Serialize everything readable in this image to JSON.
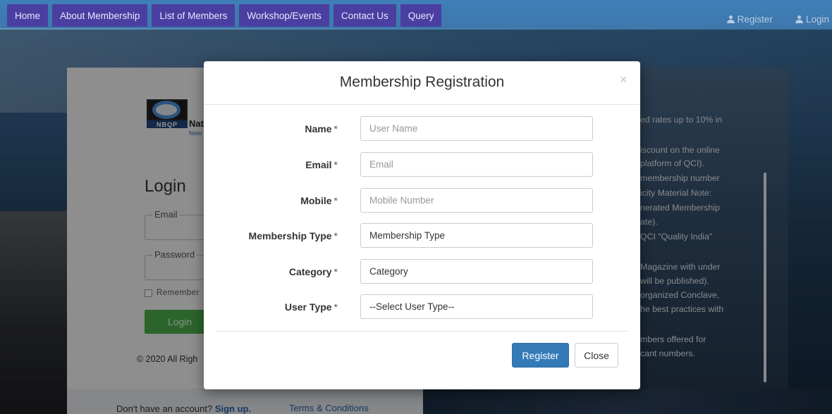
{
  "nav": {
    "items": [
      {
        "label": "Home"
      },
      {
        "label": "About Membership"
      },
      {
        "label": "List of Members"
      },
      {
        "label": "Workshop/Events"
      },
      {
        "label": "Contact Us"
      },
      {
        "label": "Query"
      }
    ],
    "register_label": "Register",
    "login_label": "Login"
  },
  "login_card": {
    "logo_text": "NBQP",
    "logo_name_partial": "Nat",
    "logo_subtext_partial": "Netw",
    "title": "Login",
    "email_label": "Email",
    "password_label": "Password",
    "remember_label": "Remember",
    "login_button": "Login",
    "copyright": "© 2020 All Righ",
    "signup_text": "Don't have an account?",
    "signup_link": "Sign up.",
    "terms_link": "Terms & Conditions"
  },
  "info_panel": {
    "lines": [
      "ed rates up to 10% in",
      "iscount on the online",
      "platform of QCI).",
      "membership number",
      "icity Material Note:",
      "nerated Membership",
      "ate).",
      "QCI \"Quality India\"",
      "Magazine with under",
      "will be published).",
      "organized Conclave,",
      "he best practices with",
      "mbers offered for",
      "cant numbers."
    ]
  },
  "modal": {
    "title": "Membership Registration",
    "close_x": "×",
    "fields": [
      {
        "label": "Name",
        "placeholder": "User Name"
      },
      {
        "label": "Email",
        "placeholder": "Email"
      },
      {
        "label": "Mobile",
        "placeholder": "Mobile Number"
      }
    ],
    "selects": [
      {
        "label": "Membership Type",
        "value": "Membership Type"
      },
      {
        "label": "Category",
        "value": "Category"
      },
      {
        "label": "User Type",
        "value": "--Select User Type--"
      }
    ],
    "required_mark": "*",
    "register_button": "Register",
    "close_button": "Close"
  },
  "colors": {
    "nav_bg": "#4a3fa0",
    "primary_button": "#337ab7",
    "login_button": "#4cae4c"
  }
}
